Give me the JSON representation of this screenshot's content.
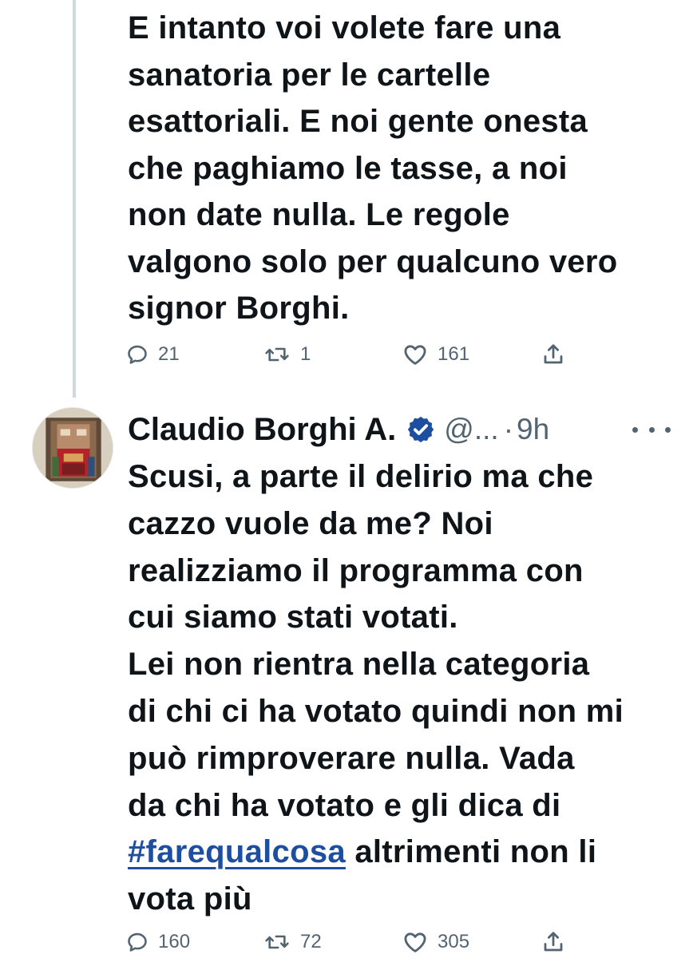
{
  "tweet1": {
    "text": "E intanto voi volete fare una\nsanatoria per le cartelle\nesattoriali. E noi gente onesta\nche paghiamo le tasse, a noi\nnon date nulla. Le regole\nvalgono solo per qualcuno vero\nsignor Borghi.",
    "actions": {
      "reply_icon": "reply-icon",
      "reply_count": "21",
      "retweet_icon": "retweet-icon",
      "retweet_count": "1",
      "like_icon": "heart-icon",
      "like_count": "161",
      "share_icon": "share-icon"
    }
  },
  "tweet2": {
    "author_name": "Claudio Borghi A.",
    "verified_icon": "verified-badge-icon",
    "handle": "@...",
    "separator": "·",
    "timestamp": "9h",
    "more_icon": "more-options-icon",
    "text_before_hashtag": "Scusi, a parte il delirio ma che\ncazzo vuole da me? Noi\nrealizziamo il programma con\ncui siamo stati votati.\nLei non rientra nella categoria\ndi chi ci ha votato quindi non mi\npuò rimproverare nulla. Vada\nda chi ha votato e gli dica di\n",
    "hashtag": "#farequalcosa",
    "text_after_hashtag": " altrimenti non li\nvota più",
    "actions": {
      "reply_icon": "reply-icon",
      "reply_count": "160",
      "retweet_icon": "retweet-icon",
      "retweet_count": "72",
      "like_icon": "heart-icon",
      "like_count": "305",
      "share_icon": "share-icon"
    }
  },
  "colors": {
    "text": "#0f1419",
    "secondary": "#536471",
    "link": "#1d4e9f",
    "verified": "#1d4e9f",
    "thread_line": "#cfd9de"
  }
}
